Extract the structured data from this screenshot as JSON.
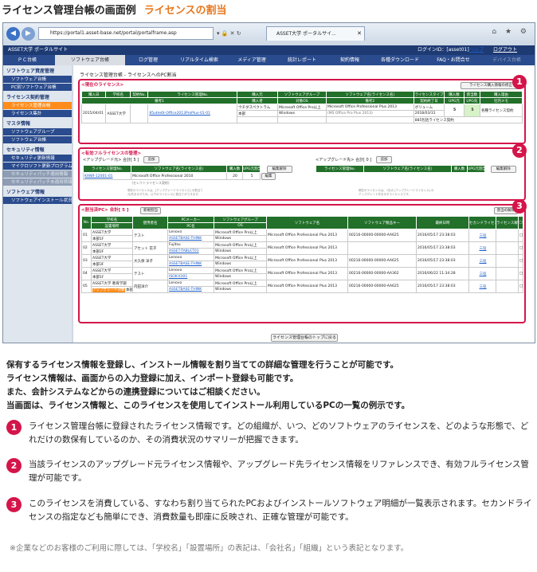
{
  "heading": {
    "title": "ライセンス管理台帳の画面例",
    "subtitle": "ライセンスの割当"
  },
  "browser": {
    "url": "https://portal1.asset-base.net/portal/portalframe.asp",
    "url_icons": "▾ 🔒 ✕ ↻",
    "tab_title": "ASSET大学 ポータルサイ...",
    "controls": "⌂ ★ ⚙"
  },
  "topbar": {
    "site": "ASSET大学 ポータルサイト",
    "login": "ログインID：[asset01]",
    "help": "ヘルプ",
    "logout": "ログアウト"
  },
  "nav": [
    "ＰＣ台帳",
    "ソフトウェア台帳",
    "ログ管理",
    "リアルタイム検索",
    "メディア管理",
    "統計レポート",
    "契約情報",
    "各種ダウンロード",
    "FAQ・お問合せ",
    "デバイス台帳"
  ],
  "sidebar": {
    "sections": [
      {
        "title": "ソフトウェア資産管理",
        "items": [
          {
            "label": "ソフトウェア台帳",
            "state": "normal"
          },
          {
            "label": "PC別ソフトウェア台帳",
            "state": "normal"
          }
        ]
      },
      {
        "title": "ライセンス契約管理",
        "items": [
          {
            "label": "ライセンス管理台帳",
            "state": "active"
          },
          {
            "label": "ライセンス集計",
            "state": "normal"
          }
        ]
      },
      {
        "title": "マスタ情報",
        "items": [
          {
            "label": "ソフトウェアグループ",
            "state": "normal"
          },
          {
            "label": "ソフトウェア台帳",
            "state": "normal"
          }
        ]
      },
      {
        "title": "セキュリティ情報",
        "items": [
          {
            "label": "セキュリティ更新情報",
            "state": "normal"
          },
          {
            "label": "マイクロソフト更新プログラム情報",
            "state": "normal"
          },
          {
            "label": "セキュリティパッチ適用情報",
            "state": "off"
          },
          {
            "label": "セキュリティパッチ未適用情報",
            "state": "off"
          }
        ]
      },
      {
        "title": "ソフトウェア情報",
        "items": [
          {
            "label": "ソフトウェアインストール状況",
            "state": "normal"
          }
        ]
      }
    ]
  },
  "breadcrumb": "ライセンス管理台帳 - ライセンスへのPC割当",
  "panel1": {
    "title": "<現在のライセンス>",
    "button": "ライセンス購入情報の修正",
    "headers": [
      "購入日",
      "学校名",
      "契約No.",
      "ライセンス管理No.",
      "購入元",
      "ソフトウェアグループ",
      "ソフトウェア名(ライセンス名)",
      "ライセンスタイプ",
      "購入数",
      "割当数",
      "購入理由"
    ],
    "headers2": [
      "備考1",
      "購入者",
      "対象OS",
      "備考2",
      "契約終了日",
      "UPG元",
      "UPG先",
      "備考3",
      "ライセンス契約No.",
      "社内メモ"
    ],
    "row": {
      "date": "2015/04/01",
      "school": "ASSET大学",
      "contract": "",
      "license_no": "85uHe6t-Office2013ProPlus-01-01",
      "vendor": "ウチダスペクトラム",
      "group": "Microsoft Office Pro以上",
      "software": "Microsoft Office Professional Plus 2013",
      "software_sub": "(MS Office Pro Plus 2013)",
      "type": "ボリューム",
      "purchased": "5",
      "assigned": "5",
      "reason": "各種ライセンス契約",
      "buyer": "本部",
      "os": "Windows",
      "end_date": "2018/03/31",
      "upg_from": "",
      "upg_to": "0",
      "license_contract": "885包括ライセンス契約"
    }
  },
  "panel2": {
    "title": "<有効フルライセンスの管理>",
    "upgrade_from": "<アップグレード元> 合計[ 5 ]",
    "upgrade_to": "<アップグレード先> 合計[ 0 ]",
    "add": "追加",
    "headers": [
      "ライセンス管理No.",
      "ソフトウェア名(ライセンス名)",
      "購入数",
      "UPG元割当数"
    ],
    "row": {
      "license_no": "KANR-12001-01",
      "software": "Microsoft Office Professional 2010",
      "software_sub": "(セレクトライセンス契約)",
      "purchased": "20",
      "assigned": "5",
      "edit": "編集"
    },
    "edit_button": "編集解除",
    "note_left": "現在のライセンスは、[アップグレードライセンス] の割当て\n元/先を示すため、以下のライセンスに割当てができます。",
    "note_right": "現在のライセンスは、1社の [アップグレードライセンス] の\nアップグレード先を示すライセンスです。"
  },
  "panel3": {
    "title": "<割当済PC> 合計[ 5 ]",
    "new_button": "新規割当",
    "delete_button": "割当の解除",
    "headers": [
      "No.",
      "学校名",
      "使用者名",
      "PCメーカー",
      "ソフトウェアグループ",
      "ソフトウェア名",
      "ソフトウェア製品キー",
      "最終日時",
      "セカンドライセンス",
      "ライセンス解除"
    ],
    "headers2": [
      "設置場所",
      "PC名",
      "OS"
    ],
    "rows": [
      {
        "no": "01",
        "school": "ASSET大学",
        "place": "本部1F",
        "user": "テスト",
        "maker": "Lenovo",
        "pc": "ASSETBASE-THINK",
        "group": "Microsoft Office Pro以上",
        "os": "Windows",
        "software": "Microsoft Office Professional Plus 2013",
        "key": "00216-00000-00000-AA625",
        "date": "2016/05/17 23:38:03",
        "second": "三役",
        "hl": false
      },
      {
        "no": "02",
        "school": "ASSET大学",
        "place": "本部2F",
        "user": "アセット 花子",
        "maker": "Fujitsu",
        "pc": "ASSET-TABLET01",
        "group": "Microsoft Office Pro以上",
        "os": "Windows",
        "software": "Microsoft Office Professional Plus 2013",
        "key": "",
        "date": "2016/05/17 23:38:03",
        "second": "三役",
        "hl": false
      },
      {
        "no": "03",
        "school": "ASSET大学",
        "place": "本部3F",
        "user": "大久保 洋子",
        "maker": "Lenovo",
        "pc": "ASSETBASE-THINK",
        "group": "Microsoft Office Pro以上",
        "os": "Windows",
        "software": "Microsoft Office Professional Plus 2013",
        "key": "00216-00000-00000-AA625",
        "date": "2016/05/17 23:38:03",
        "second": "三役",
        "hl": false
      },
      {
        "no": "04",
        "school": "ASSET大学",
        "place": "本部1F",
        "user": "テスト",
        "maker": "Lenovo",
        "pc": "ISOK-X301",
        "group": "Microsoft Office Pro以上",
        "os": "Windows",
        "software": "Microsoft Office Professional Plus 2013",
        "key": "00216-00000-00000-AA362",
        "date": "2016/06/22 11:34:28",
        "second": "三役",
        "hl": false
      },
      {
        "no": "05",
        "school": "ASSET大学 教育学部",
        "place": "本部2F",
        "user": "内田洋介",
        "maker": "Lenovo",
        "pc": "ASSETBASE-THINK",
        "group": "Microsoft Office Pro以上",
        "os": "Windows",
        "software": "Microsoft Office Professional Plus 2013",
        "key": "00216-00000-00000-AA625",
        "date": "2016/05/17 23:38:03",
        "second": "三役",
        "hl": true,
        "hl_text": "アップグレード対象"
      }
    ]
  },
  "bottom_button": "ライセンス管理台帳のトップに戻る",
  "description": [
    "保有するライセンス情報を登録し、インストール情報を割り当てての詳細な管理を行うことが可能です。",
    "ライセンス情報は、画面からの入力登録に加え、インポート登録も可能です。",
    "また、会計システムなどからの連携登録についてはご相談ください。",
    "当画面は、ライセンス情報と、このライセンスを使用してインストール利用しているPCの一覧の例示です。"
  ],
  "items": [
    {
      "num": "1",
      "text": "ライセンス管理台帳に登録されたライセンス情報です。どの組織が、いつ、どのソフトウェアのライセンスを、どのような形態で、どれだけの数保有しているのか、その消費状況のサマリーが把握できます。"
    },
    {
      "num": "2",
      "text": "当該ライセンスのアップグレード元ライセンス情報や、アップグレード先ライセンス情報をリファレンスでき、有効フルライセンス管理が可能です。"
    },
    {
      "num": "3",
      "text": "このライセンスを消費している、すなわち割り当てられたPCおよびインストールソフトウェア明細が一覧表示されます。セカンドライセンスの指定なども簡単にでき、消費数量も即座に反映され、正確な管理が可能です。"
    }
  ],
  "note": "※企業などのお客様のご利用に際しては、「学校名」「設置場所」の表記は、「会社名」「組織」という表記となります。",
  "colors": {
    "accent": "#e8771e",
    "panel_border": "#d4154a",
    "table_header": "#22702a",
    "nav": "#2a4b8d"
  }
}
